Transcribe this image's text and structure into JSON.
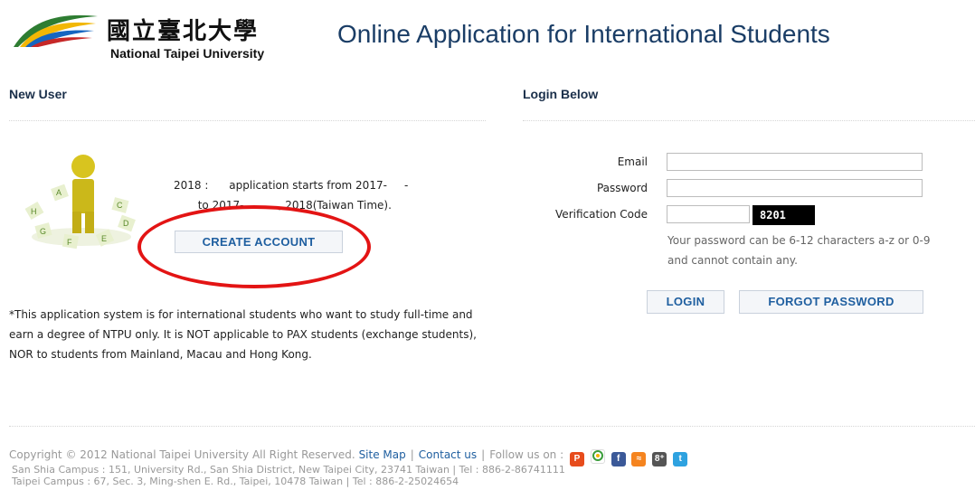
{
  "header": {
    "university_cn": "國立臺北大學",
    "university_en": "National Taipei University",
    "app_title": "Online Application for International Students"
  },
  "new_user": {
    "title": "New User",
    "period_line1": "2018 :      application starts from 2017-     -",
    "period_line2": "       to 2017-          , 2018(Taiwan Time).",
    "create_account_label": "CREATE ACCOUNT",
    "notice": "*This application system is for international students who want to study full-time and earn a degree of NTPU only. It is NOT applicable to PAX students (exchange students), NOR to students from Mainland, Macau and Hong Kong."
  },
  "login": {
    "title": "Login Below",
    "email_label": "Email",
    "password_label": "Password",
    "verification_label": "Verification Code",
    "email_value": "",
    "password_value": "",
    "verification_value": "",
    "captcha": "8201",
    "password_hint": "Your password can be 6-12 characters a-z or 0-9 and cannot contain any.",
    "login_label": "LOGIN",
    "forgot_label": "FORGOT PASSWORD"
  },
  "footer": {
    "copyright": "Copyright © 2012 National Taipei University All Right Reserved.",
    "site_map": "Site Map",
    "contact": "Contact us",
    "follow": "Follow us on :",
    "social_icons": [
      "plurk-icon",
      "picasa-icon",
      "facebook-icon",
      "rss-icon",
      "google-plus-icon",
      "twitter-icon"
    ],
    "san_shia": "San Shia Campus : 151, University Rd., San Shia District, New Taipei City, 23741 Taiwan  |  Tel : 886-2-86741111",
    "taipei": "Taipei Campus : 67, Sec. 3, Ming-shen E. Rd., Taipei, 10478 Taiwan  |  Tel : 886-2-25024654"
  },
  "colors": {
    "title_blue": "#1a3d66",
    "button_text": "#1f5fa0",
    "annotation_red": "#e31414",
    "figure_yellow": "#d8c41f"
  }
}
